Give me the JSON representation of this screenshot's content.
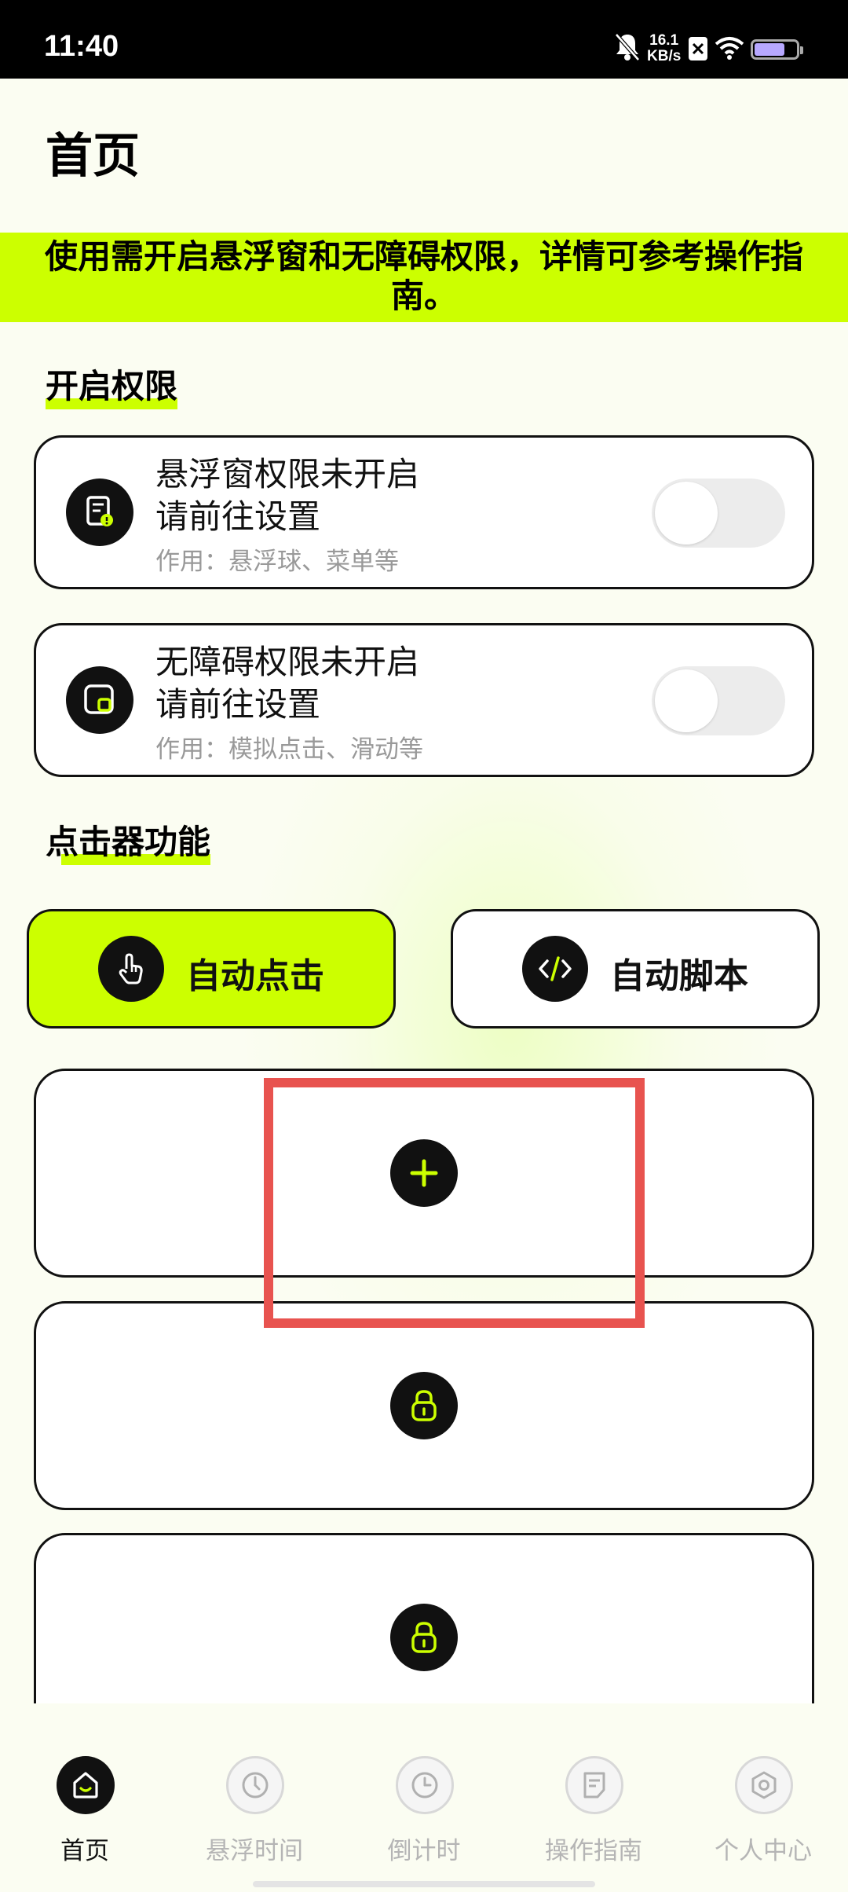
{
  "status_bar": {
    "time": "11:40",
    "net_speed_value": "16.1",
    "net_speed_unit": "KB/s"
  },
  "header": {
    "title": "首页"
  },
  "notice": {
    "text": "使用需开启悬浮窗和无障碍权限，详情可参考操作指南。"
  },
  "permissions": {
    "section_title": "开启权限",
    "overlay": {
      "line1": "悬浮窗权限未开启",
      "line2": "请前往设置",
      "note": "作用：悬浮球、菜单等",
      "enabled": false
    },
    "accessibility": {
      "line1": "无障碍权限未开启",
      "line2": "请前往设置",
      "note": "作用：模拟点击、滑动等",
      "enabled": false
    }
  },
  "features": {
    "section_title": "点击器功能",
    "auto_click_label": "自动点击",
    "auto_script_label": "自动脚本"
  },
  "slots": [
    {
      "state": "add",
      "icon": "plus-icon"
    },
    {
      "state": "locked",
      "icon": "lock-icon"
    },
    {
      "state": "locked",
      "icon": "lock-icon"
    }
  ],
  "bottom_nav": [
    {
      "label": "首页",
      "icon": "home-icon",
      "active": true
    },
    {
      "label": "悬浮时间",
      "icon": "stopwatch-icon",
      "active": false
    },
    {
      "label": "倒计时",
      "icon": "clock-icon",
      "active": false
    },
    {
      "label": "操作指南",
      "icon": "guide-icon",
      "active": false
    },
    {
      "label": "个人中心",
      "icon": "settings-icon",
      "active": false
    }
  ],
  "colors": {
    "accent": "#ccff00",
    "highlight_box": "#e8534f",
    "dark": "#111111"
  }
}
